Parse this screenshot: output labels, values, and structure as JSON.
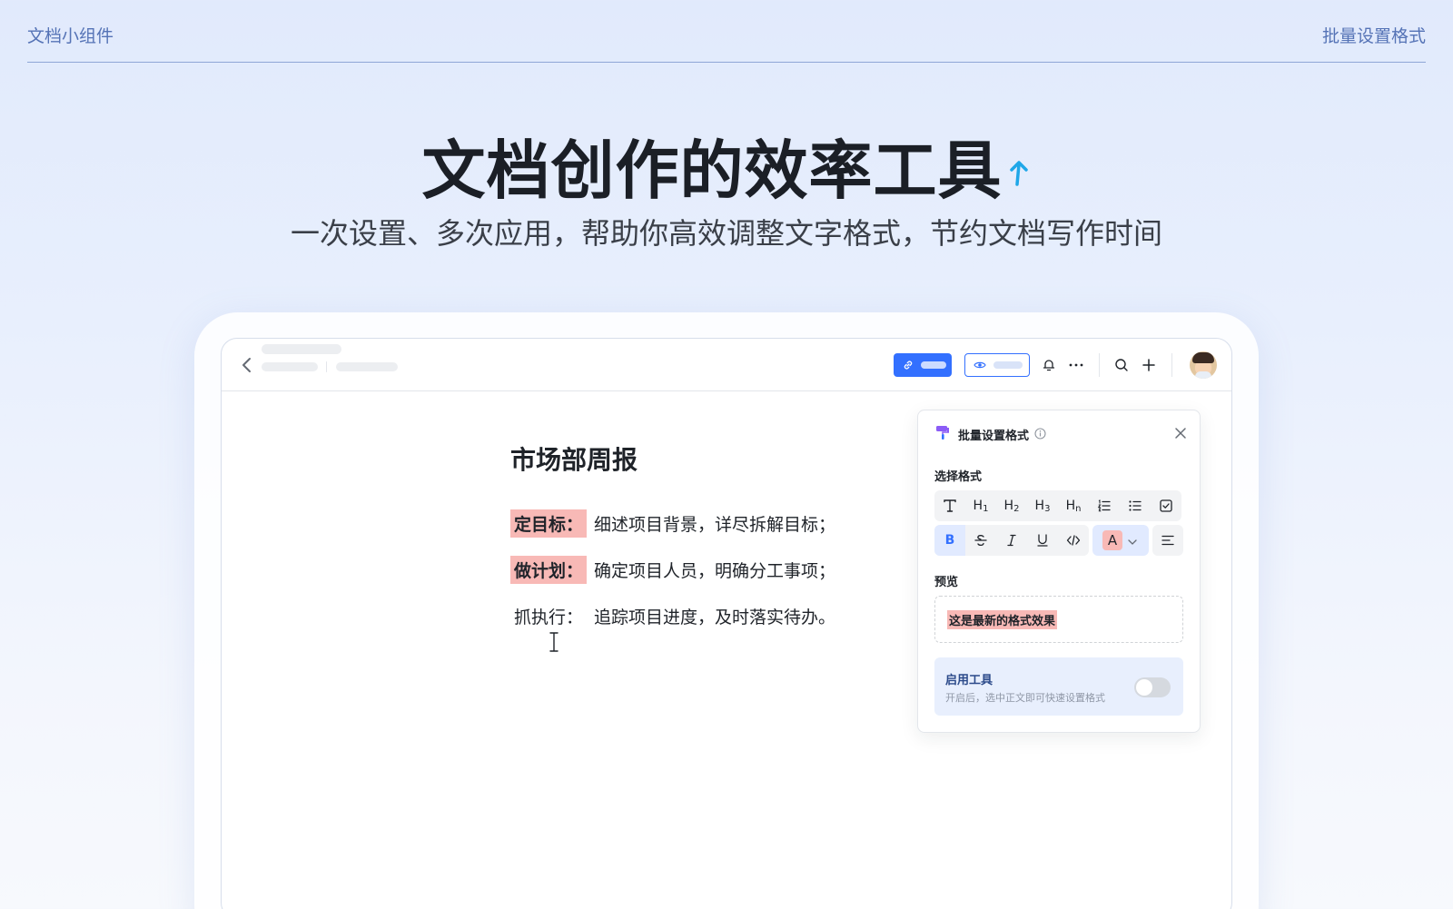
{
  "site": {
    "left_link": "文档小组件",
    "right_link": "批量设置格式"
  },
  "hero": {
    "title": "文档创作的效率工具",
    "subtitle": "一次设置、多次应用，帮助你高效调整文字格式，节约文档写作时间"
  },
  "doc": {
    "title": "市场部周报",
    "lines": [
      {
        "label": "定目标：",
        "text": "细述项目背景，详尽拆解目标；"
      },
      {
        "label": "做计划：",
        "text": "确定项目人员，明确分工事项；"
      },
      {
        "label": "抓执行：",
        "text": "追踪项目进度，及时落实待办。"
      }
    ]
  },
  "panel": {
    "title": "批量设置格式",
    "select_label": "选择格式",
    "row1": [
      "T",
      "H1",
      "H2",
      "H3",
      "Hn",
      "ordered-list-icon",
      "bullet-list-icon",
      "checkbox-icon"
    ],
    "preview_label": "预览",
    "preview_text": "这是最新的格式效果",
    "enable_title": "启用工具",
    "enable_desc": "开启后，选中正文即可快速设置格式",
    "toggle_on": false
  },
  "colors": {
    "accent": "#3370ff",
    "highlight": "#f8b9b6",
    "hero_arrow": "#1fa7e8"
  }
}
